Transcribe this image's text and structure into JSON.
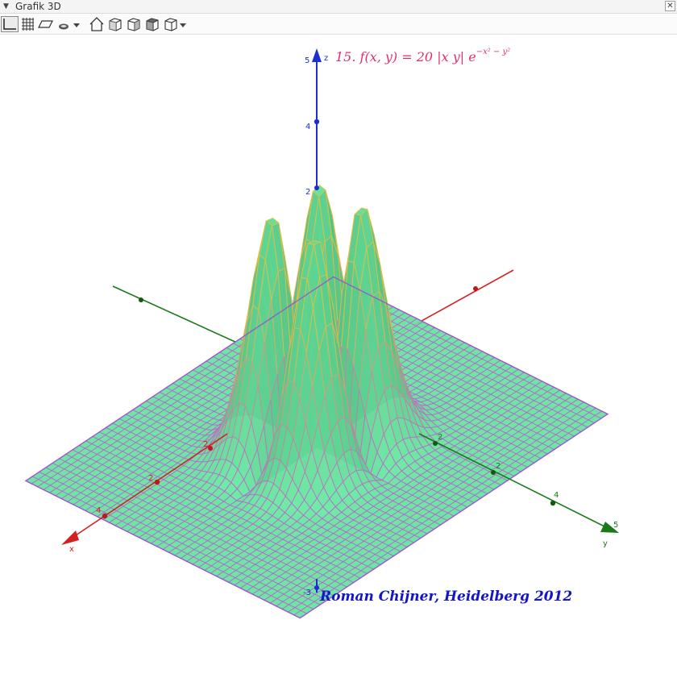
{
  "panel": {
    "title": "Grafik 3D",
    "close_symbol": "✕"
  },
  "toolbar": {
    "buttons": [
      {
        "name": "axes-toggle-button",
        "icon": "axes-icon",
        "selected": true
      },
      {
        "name": "grid-toggle-button",
        "icon": "grid-icon"
      },
      {
        "name": "plane-toggle-button",
        "icon": "plane-icon"
      },
      {
        "name": "clipping-box-button",
        "icon": "clipping-icon",
        "has_dropdown": true
      },
      {
        "name": "standard-view-button",
        "icon": "home-icon"
      },
      {
        "name": "view-xy-button",
        "icon": "cube-front-icon"
      },
      {
        "name": "view-xz-button",
        "icon": "cube-side-icon"
      },
      {
        "name": "view-yz-button",
        "icon": "cube-top-icon"
      },
      {
        "name": "projection-button",
        "icon": "projection-icon",
        "has_dropdown": true
      }
    ]
  },
  "graph": {
    "formula_prefix": "15. f(x, y) = 20 |x y|  e",
    "formula_exponent": "−x² − y²",
    "formula_color": "#e0306a",
    "author": "Roman Chijner, Heidelberg 2012",
    "author_color": "#1414c8",
    "surface_color": "#66e8a0",
    "mesh_color_low": "#c05cd8",
    "mesh_color_high": "#e8c040",
    "x_axis": {
      "label": "x",
      "color": "#d42020",
      "ticks": [
        "4",
        "2",
        "2"
      ]
    },
    "y_axis": {
      "label": "y",
      "color": "#1a7a1a",
      "ticks": [
        "5",
        "4",
        "2",
        "2",
        "2"
      ]
    },
    "z_axis": {
      "label": "z",
      "color": "#1e2fd0",
      "ticks": [
        "5",
        "4",
        "2",
        "-3"
      ]
    }
  }
}
